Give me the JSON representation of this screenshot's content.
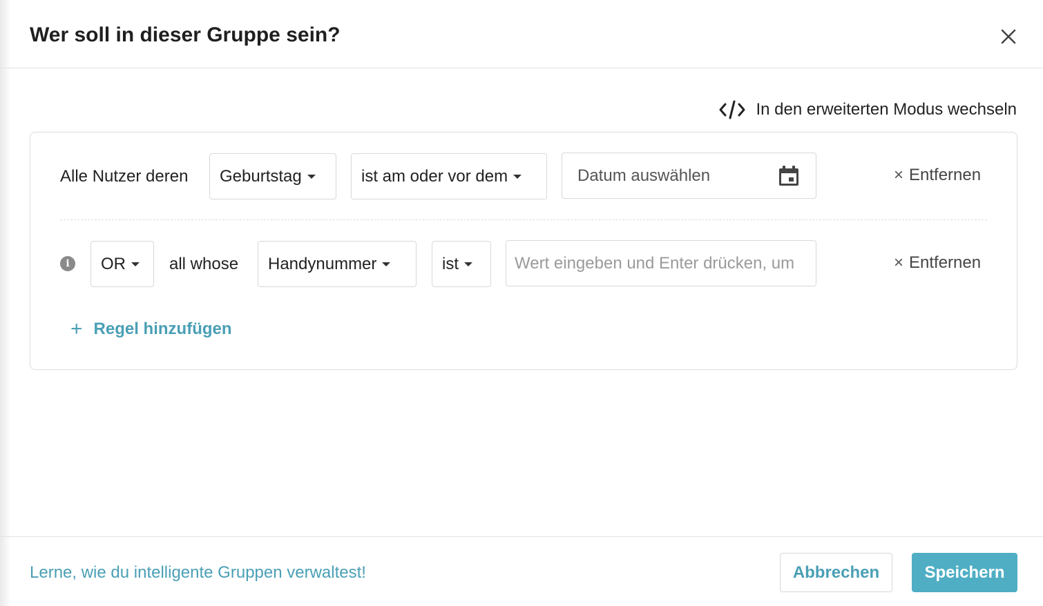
{
  "dialog": {
    "title": "Wer soll in dieser Gruppe sein?"
  },
  "advanced_mode": {
    "label": "In den erweiterten Modus wechseln",
    "icon": "code-icon"
  },
  "rules": [
    {
      "prefix": "Alle Nutzer deren",
      "field": "Geburtstag",
      "operator": "ist am oder vor dem",
      "value_placeholder": "Datum auswählen",
      "value_icon": "calendar-icon",
      "remove_label": "Entfernen"
    },
    {
      "conjunction": "OR",
      "prefix": "all whose",
      "field": "Handynummer",
      "operator": "ist",
      "value_placeholder": "Wert eingeben und Enter drücken, um",
      "remove_label": "Entfernen"
    }
  ],
  "add_rule": {
    "label": "Regel hinzufügen"
  },
  "footer": {
    "help_link": "Lerne, wie du intelligente Gruppen verwaltest!",
    "cancel_label": "Abbrechen",
    "save_label": "Speichern"
  },
  "colors": {
    "accent": "#4a9fb5",
    "primary_button": "#4faec4"
  }
}
